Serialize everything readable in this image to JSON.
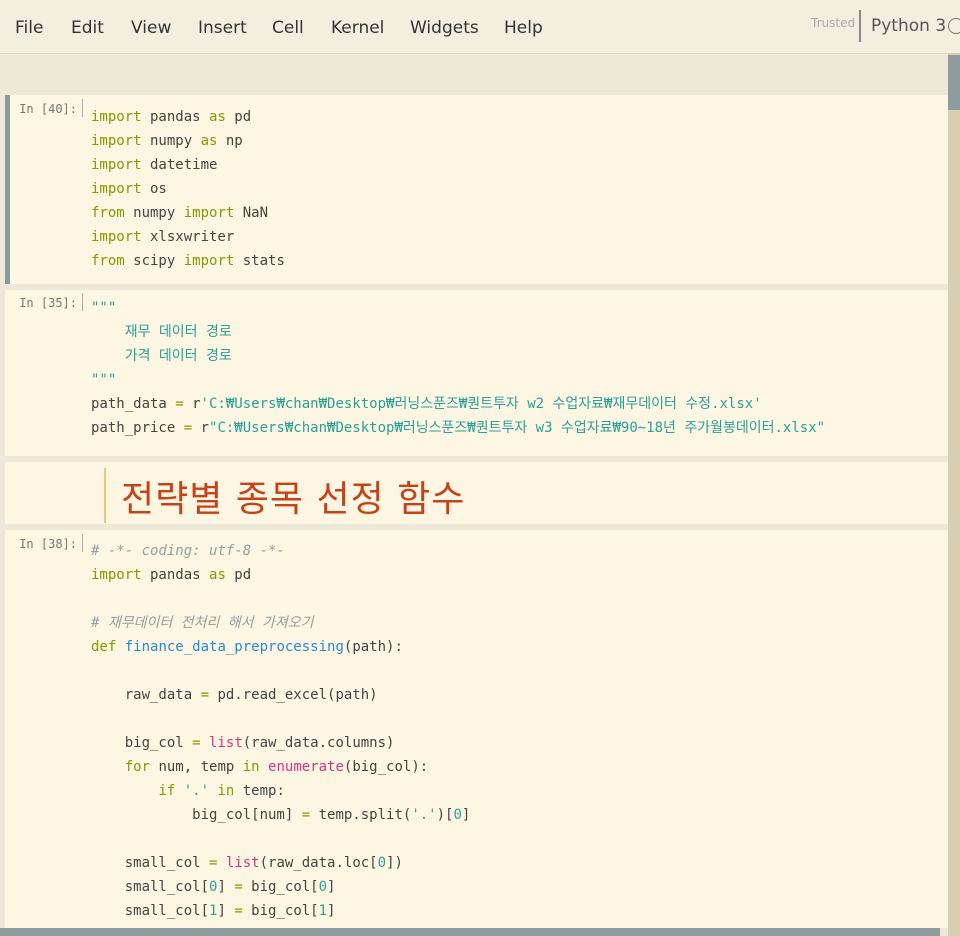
{
  "menubar": {
    "items": [
      "File",
      "Edit",
      "View",
      "Insert",
      "Cell",
      "Kernel",
      "Widgets",
      "Help"
    ],
    "trusted_label": "Trusted",
    "kernel_name": "Python 3"
  },
  "cells": {
    "c1": {
      "prompt": "In [40]:",
      "lines": [
        [
          [
            "kw",
            "import"
          ],
          [
            "plain",
            " pandas "
          ],
          [
            "kw",
            "as"
          ],
          [
            "plain",
            " pd"
          ]
        ],
        [
          [
            "kw",
            "import"
          ],
          [
            "plain",
            " numpy "
          ],
          [
            "kw",
            "as"
          ],
          [
            "plain",
            " np"
          ]
        ],
        [
          [
            "kw",
            "import"
          ],
          [
            "plain",
            " datetime"
          ]
        ],
        [
          [
            "kw",
            "import"
          ],
          [
            "plain",
            " os"
          ]
        ],
        [
          [
            "kw",
            "from"
          ],
          [
            "plain",
            " numpy "
          ],
          [
            "kw",
            "import"
          ],
          [
            "plain",
            " NaN"
          ]
        ],
        [
          [
            "kw",
            "import"
          ],
          [
            "plain",
            " xlsxwriter"
          ]
        ],
        [
          [
            "kw",
            "from"
          ],
          [
            "plain",
            " scipy "
          ],
          [
            "kw",
            "import"
          ],
          [
            "plain",
            " stats"
          ]
        ]
      ]
    },
    "c2": {
      "prompt": "In [35]:",
      "lines": [
        [
          [
            "str",
            "\"\"\""
          ]
        ],
        [
          [
            "str",
            "    재무 데이터 경로"
          ]
        ],
        [
          [
            "str",
            "    가격 데이터 경로"
          ]
        ],
        [
          [
            "str",
            "\"\"\""
          ]
        ],
        [
          [
            "plain",
            "path_data "
          ],
          [
            "kw",
            "="
          ],
          [
            "plain",
            " r"
          ],
          [
            "str",
            "'C:₩Users₩chan₩Desktop₩러닝스푼즈₩퀀트투자 w2 수업자료₩재무데이터 수정.xlsx'"
          ]
        ],
        [
          [
            "plain",
            "path_price "
          ],
          [
            "kw",
            "="
          ],
          [
            "plain",
            " r"
          ],
          [
            "str",
            "\"C:₩Users₩chan₩Desktop₩러닝스푼즈₩퀀트투자 w3 수업자료₩90~18년 주가월봉데이터.xlsx\""
          ]
        ]
      ]
    },
    "markdown": {
      "heading": "전략별 종목 선정 함수"
    },
    "c3": {
      "prompt": "In [38]:",
      "lines": [
        [
          [
            "cm",
            "# -*- coding: utf-8 -*-"
          ]
        ],
        [
          [
            "kw",
            "import"
          ],
          [
            "plain",
            " pandas "
          ],
          [
            "kw",
            "as"
          ],
          [
            "plain",
            " pd"
          ]
        ],
        [],
        [
          [
            "cm",
            "# 재무데이터 전처리 해서 가져오기"
          ]
        ],
        [
          [
            "kw",
            "def"
          ],
          [
            "plain",
            " "
          ],
          [
            "fn",
            "finance_data_preprocessing"
          ],
          [
            "plain",
            "(path):"
          ]
        ],
        [],
        [
          [
            "plain",
            "    raw_data "
          ],
          [
            "kw",
            "="
          ],
          [
            "plain",
            " pd.read_excel(path)"
          ]
        ],
        [],
        [
          [
            "plain",
            "    big_col "
          ],
          [
            "kw",
            "="
          ],
          [
            "plain",
            " "
          ],
          [
            "bi",
            "list"
          ],
          [
            "plain",
            "(raw_data.columns)"
          ]
        ],
        [
          [
            "plain",
            "    "
          ],
          [
            "kw",
            "for"
          ],
          [
            "plain",
            " num, temp "
          ],
          [
            "kw",
            "in"
          ],
          [
            "plain",
            " "
          ],
          [
            "bi",
            "enumerate"
          ],
          [
            "plain",
            "(big_col):"
          ]
        ],
        [
          [
            "plain",
            "        "
          ],
          [
            "kw",
            "if"
          ],
          [
            "plain",
            " "
          ],
          [
            "str",
            "'.'"
          ],
          [
            "plain",
            " "
          ],
          [
            "kw",
            "in"
          ],
          [
            "plain",
            " temp:"
          ]
        ],
        [
          [
            "plain",
            "            big_col[num] "
          ],
          [
            "kw",
            "="
          ],
          [
            "plain",
            " temp.split("
          ],
          [
            "str",
            "'.'"
          ],
          [
            "plain",
            ")["
          ],
          [
            "num",
            "0"
          ],
          [
            "plain",
            "]"
          ]
        ],
        [],
        [
          [
            "plain",
            "    small_col "
          ],
          [
            "kw",
            "="
          ],
          [
            "plain",
            " "
          ],
          [
            "bi",
            "list"
          ],
          [
            "plain",
            "(raw_data.loc["
          ],
          [
            "num",
            "0"
          ],
          [
            "plain",
            "])"
          ]
        ],
        [
          [
            "plain",
            "    small_col["
          ],
          [
            "num",
            "0"
          ],
          [
            "plain",
            "] "
          ],
          [
            "kw",
            "="
          ],
          [
            "plain",
            " big_col["
          ],
          [
            "num",
            "0"
          ],
          [
            "plain",
            "]"
          ]
        ],
        [
          [
            "plain",
            "    small_col["
          ],
          [
            "num",
            "1"
          ],
          [
            "plain",
            "] "
          ],
          [
            "kw",
            "="
          ],
          [
            "plain",
            " big_col["
          ],
          [
            "num",
            "1"
          ],
          [
            "plain",
            "]"
          ]
        ]
      ]
    }
  }
}
